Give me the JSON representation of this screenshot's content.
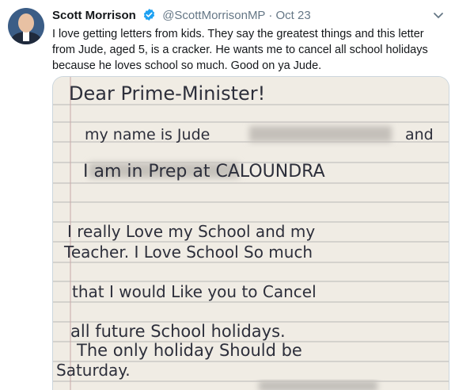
{
  "tweet": {
    "author_name": "Scott Morrison",
    "handle": "@ScottMorrisonMP",
    "separator": "·",
    "date": "Oct 23",
    "text": "I love getting letters from kids. They say the greatest things and this letter from Jude, aged 5, is a cracker. He wants me to cancel all school holidays because he loves school so much. Good on ya Jude.",
    "icons": {
      "verified": "verified-badge-icon",
      "menu": "chevron-down-icon",
      "avatar": "profile-photo"
    },
    "colors": {
      "verified": "#1da1f2",
      "handle": "#657786",
      "text": "#14171a"
    }
  },
  "letter": {
    "lines": [
      "Dear Prime-Minister!",
      "my name is Jude",
      "and",
      "I am in Prep at CALOUNDRA",
      "I really Love my School and my",
      "Teacher. I Love School So much",
      "that I would Like you to Cancel",
      "all future School holidays.",
      "The only holiday Should be",
      "Saturday."
    ]
  }
}
